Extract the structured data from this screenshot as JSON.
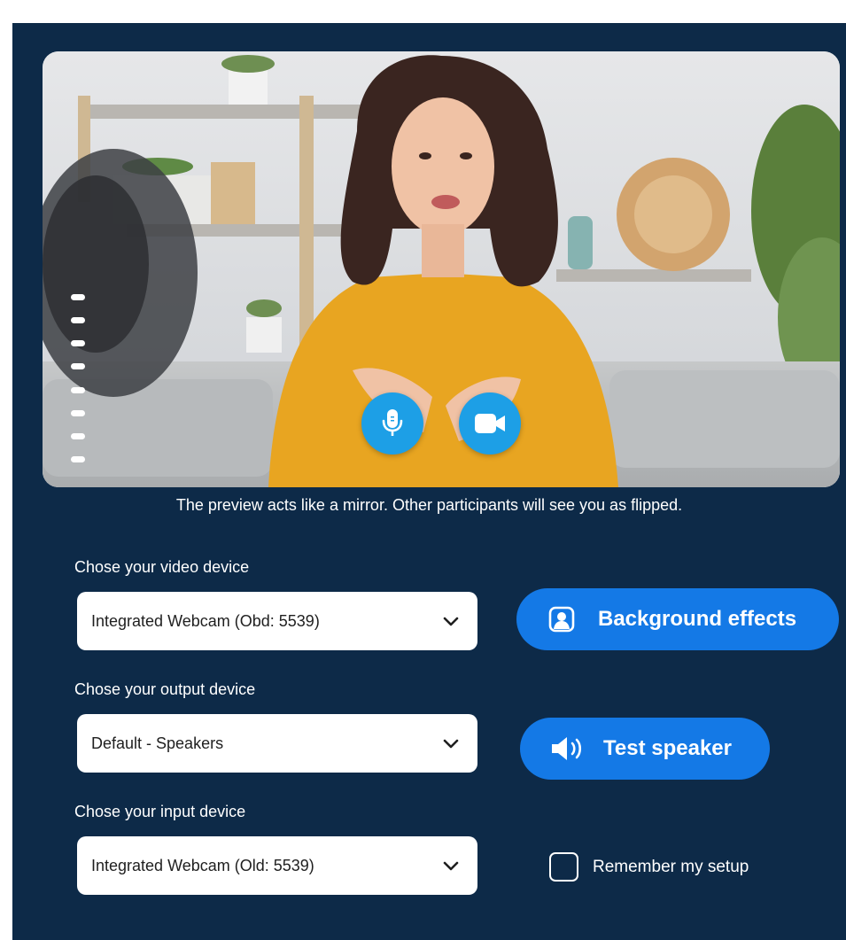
{
  "preview": {
    "note": "The preview acts like a mirror. Other participants will see you as flipped.",
    "mic_icon": "microphone-icon",
    "camera_icon": "video-camera-icon",
    "level_meter_segments": 8
  },
  "video_device": {
    "label": "Chose your video device",
    "value": "Integrated Webcam (Obd: 5539)"
  },
  "output_device": {
    "label": "Chose your output device",
    "value": "Default - Speakers"
  },
  "input_device": {
    "label": "Chose your input device",
    "value": "Integrated Webcam (Old: 5539)"
  },
  "actions": {
    "background_effects": "Background effects",
    "test_speaker": "Test speaker",
    "remember_setup": "Remember my setup",
    "remember_checked": false
  },
  "colors": {
    "panel_bg": "#0d2a48",
    "primary_button": "#1479e6",
    "round_button": "#1d9fe6"
  }
}
